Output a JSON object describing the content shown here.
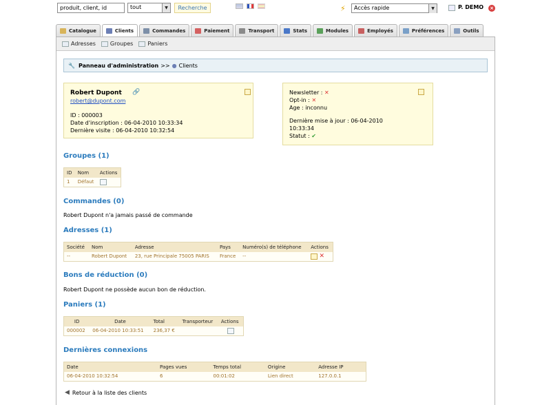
{
  "topbar": {
    "search_value": "produit, client, id",
    "search_scope": "tout",
    "search_button": "Recherche",
    "quick_access": "Accès rapide",
    "user_name": "P. DEMO"
  },
  "tabs": [
    {
      "label": "Catalogue",
      "color": "#d8b45a"
    },
    {
      "label": "Clients",
      "color": "#6c7fb5"
    },
    {
      "label": "Commandes",
      "color": "#7d8fa8"
    },
    {
      "label": "Paiement",
      "color": "#d46060"
    },
    {
      "label": "Transport",
      "color": "#8a8a8a"
    },
    {
      "label": "Stats",
      "color": "#4a78c8"
    },
    {
      "label": "Modules",
      "color": "#5aa05a"
    },
    {
      "label": "Employés",
      "color": "#c86060"
    },
    {
      "label": "Préférences",
      "color": "#7aa0c8"
    },
    {
      "label": "Outils",
      "color": "#8aa0c0"
    }
  ],
  "active_tab": "Clients",
  "subnav": [
    "Adresses",
    "Groupes",
    "Paniers"
  ],
  "breadcrumb": {
    "root": "Panneau d'administration",
    "sep": ">>",
    "current": "Clients"
  },
  "customer": {
    "name": "Robert Dupont",
    "email": "robert@dupont.com",
    "id_line": "ID : 000003",
    "signup_line": "Date d'inscription : 06-04-2010 10:33:34",
    "last_visit_line": "Dernière visite : 06-04-2010 10:32:54"
  },
  "status_card": {
    "newsletter": "Newsletter :",
    "optin": "Opt-in :",
    "age": "Age : inconnu",
    "updated": "Dernière mise à jour : 06-04-2010",
    "updated_time": "10:33:34",
    "status": "Statut :"
  },
  "groups": {
    "title": "Groupes (1)",
    "headers": [
      "ID",
      "Nom",
      "Actions"
    ],
    "rows": [
      [
        "1",
        "Défaut"
      ]
    ]
  },
  "orders": {
    "title": "Commandes (0)",
    "note": "Robert Dupont n'a jamais passé de commande"
  },
  "addresses": {
    "title": "Adresses (1)",
    "headers": [
      "Société",
      "Nom",
      "Adresse",
      "Pays",
      "Numéro(s) de téléphone",
      "Actions"
    ],
    "rows": [
      [
        "--",
        "Robert Dupont",
        "23, rue Principale 75005 PARIS",
        "France",
        "--"
      ]
    ]
  },
  "vouchers": {
    "title": "Bons de réduction (0)",
    "note": "Robert Dupont ne possède aucun bon de réduction."
  },
  "carts": {
    "title": "Paniers (1)",
    "headers": [
      "ID",
      "Date",
      "Total",
      "Transporteur",
      "Actions"
    ],
    "rows": [
      [
        "000002",
        "06-04-2010 10:33:51",
        "236,37 €",
        ""
      ]
    ]
  },
  "connections": {
    "title": "Dernières connexions",
    "headers": [
      "Date",
      "Pages vues",
      "Temps total",
      "Origine",
      "Adresse IP"
    ],
    "rows": [
      [
        "06-04-2010 10:32:54",
        "6",
        "00:01:02",
        "Lien direct",
        "127.0.0.1"
      ]
    ]
  },
  "back_link": "Retour à la liste des clients"
}
